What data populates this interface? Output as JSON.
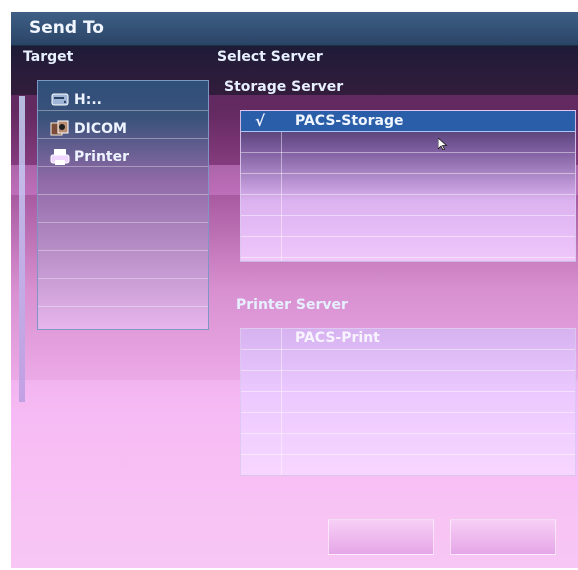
{
  "window": {
    "title": "Send To"
  },
  "target": {
    "label": "Target",
    "items": [
      {
        "label": "H:..",
        "icon": "drive-icon"
      },
      {
        "label": "DICOM",
        "icon": "dicom-icon"
      },
      {
        "label": "Printer",
        "icon": "printer-icon"
      }
    ]
  },
  "select_server": {
    "label": "Select Server",
    "storage": {
      "label": "Storage Server",
      "rows": [
        {
          "check": "√",
          "name": "PACS-Storage",
          "selected": true
        }
      ]
    },
    "printer": {
      "label": "Printer Server",
      "rows": [
        {
          "check": "",
          "name": "PACS-Print",
          "selected": false
        }
      ]
    }
  },
  "buttons": [
    {
      "label": ""
    },
    {
      "label": ""
    }
  ],
  "colors": {
    "title_bar": "#2a4466",
    "selection": "#2b5ea8",
    "text": "#eef4ff"
  }
}
